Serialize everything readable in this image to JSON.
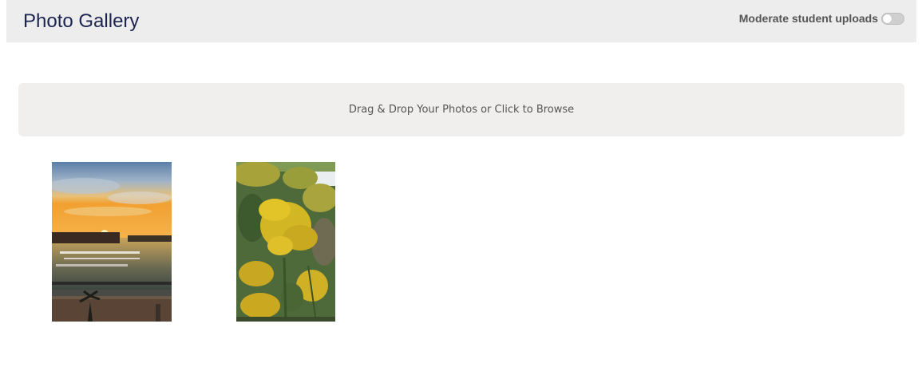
{
  "header": {
    "title": "Photo Gallery",
    "moderate_label": "Moderate student uploads",
    "moderate_enabled": false
  },
  "dropzone": {
    "text": "Drag & Drop Your Photos or Click to Browse"
  },
  "gallery": {
    "photos": [
      {
        "subject": "sunset over marina"
      },
      {
        "subject": "yellow goldenrod flowers"
      }
    ]
  }
}
